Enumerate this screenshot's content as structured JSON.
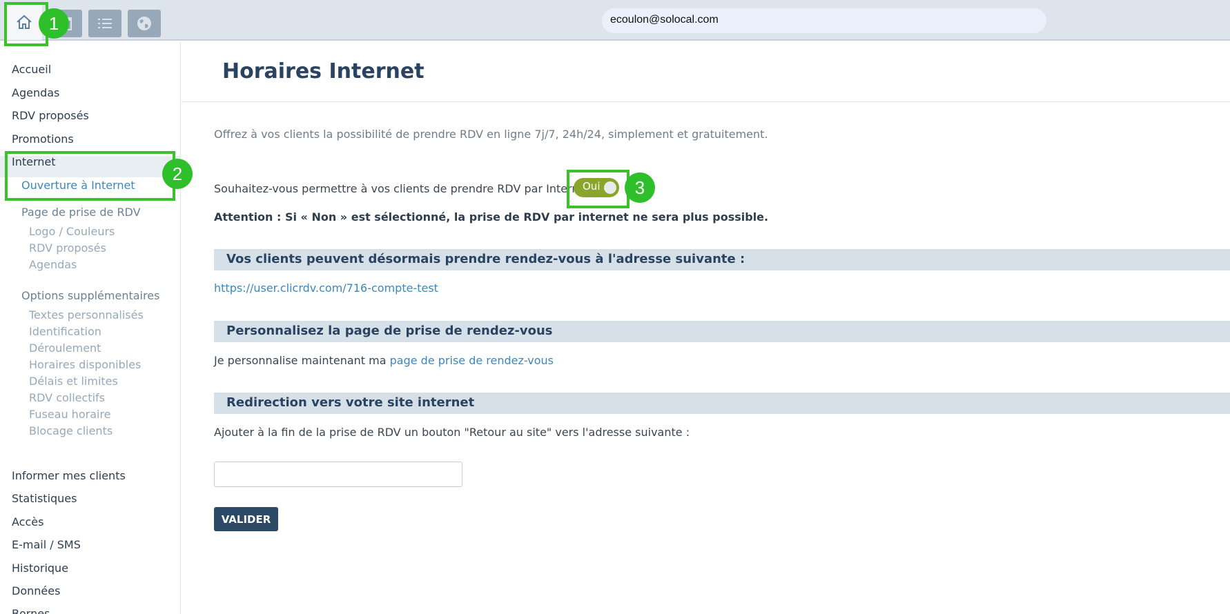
{
  "topbar": {
    "user_email": "ecoulon@solocal.com",
    "icons": [
      "home-icon",
      "calendar-icon",
      "list-icon",
      "globe-icon"
    ]
  },
  "sidebar": {
    "main_items": [
      {
        "label": "Accueil"
      },
      {
        "label": "Agendas"
      },
      {
        "label": "RDV proposés"
      },
      {
        "label": "Promotions"
      },
      {
        "label": "Internet"
      }
    ],
    "internet_active_sub": "Ouverture à Internet",
    "booking_page_group": "Page de prise de RDV",
    "booking_page_items": [
      {
        "label": "Logo / Couleurs"
      },
      {
        "label": "RDV proposés"
      },
      {
        "label": "Agendas"
      }
    ],
    "options_group": "Options supplémentaires",
    "options_items": [
      {
        "label": "Textes personnalisés"
      },
      {
        "label": "Identification"
      },
      {
        "label": "Déroulement"
      },
      {
        "label": "Horaires disponibles"
      },
      {
        "label": "Délais et limites"
      },
      {
        "label": "RDV collectifs"
      },
      {
        "label": "Fuseau horaire"
      },
      {
        "label": "Blocage clients"
      }
    ],
    "bottom_items": [
      {
        "label": "Informer mes clients"
      },
      {
        "label": "Statistiques"
      },
      {
        "label": "Accès"
      },
      {
        "label": "E-mail / SMS"
      },
      {
        "label": "Historique"
      },
      {
        "label": "Données"
      },
      {
        "label": "Bornes"
      }
    ]
  },
  "main": {
    "title": "Horaires Internet",
    "intro": "Offrez à vos clients la possibilité de prendre RDV en ligne 7j/7, 24h/24, simplement et gratuitement.",
    "question": "Souhaitez-vous permettre à vos clients de prendre RDV par Internet ?",
    "toggle_label": "Oui",
    "toggle_on": true,
    "attention": "Attention : Si « Non » est sélectionné, la prise de RDV par internet ne sera plus possible.",
    "section1_title": "Vos clients peuvent désormais prendre rendez-vous à l'adresse suivante :",
    "booking_url": "https://user.clicrdv.com/716-compte-test",
    "section2_title": "Personnalisez la page de prise de rendez-vous",
    "personalize_text": "Je personnalise maintenant ma",
    "personalize_link": "page de prise de rendez-vous",
    "section3_title": "Redirection vers votre site internet",
    "redirect_text": "Ajouter à la fin de la prise de RDV un bouton \"Retour au site\" vers l'adresse suivante :",
    "redirect_value": "",
    "submit_label": "VALIDER"
  },
  "annotations": {
    "badges": [
      "1",
      "2",
      "3"
    ],
    "color": "#3ac12b"
  },
  "colors": {
    "title": "#2a4360",
    "link": "#3b87bf",
    "toggle_on": "#8aa62a",
    "button": "#2c4966",
    "section_bg": "#d6e0e9"
  }
}
